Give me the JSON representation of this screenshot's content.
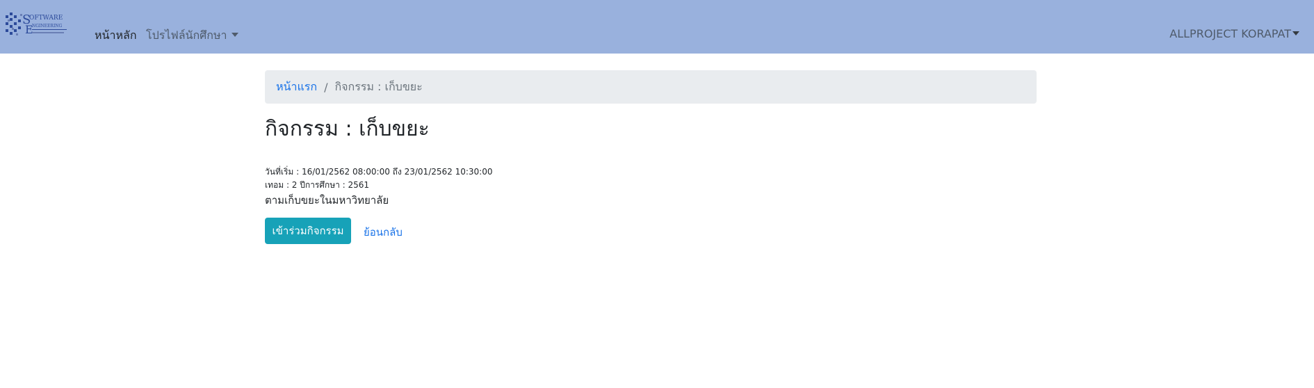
{
  "navbar": {
    "logo_text": "SOFTWARE ENGINEERING",
    "home_label": "หน้าหลัก",
    "profile_label": "โปรไฟล์นักศึกษา",
    "user_label": "ALLPROJECT KORAPAT",
    "background_color": "#99b1dd"
  },
  "breadcrumb": {
    "home_label": "หน้าแรก",
    "separator": "/",
    "current_label": "กิจกรรม : เก็บขยะ"
  },
  "activity": {
    "title": "กิจกรรม : เก็บขยะ",
    "date_line": "วันที่เริ่ม : 16/01/2562 08:00:00 ถึง 23/01/2562 10:30:00",
    "term_line": "เทอม : 2 ปีการศึกษา : 2561",
    "description": "ตามเก็บขยะในมหาวิทยาลัย"
  },
  "actions": {
    "join_label": "เข้าร่วมกิจกรรม",
    "back_label": "ย้อนกลับ",
    "join_color": "#17a2b8"
  }
}
